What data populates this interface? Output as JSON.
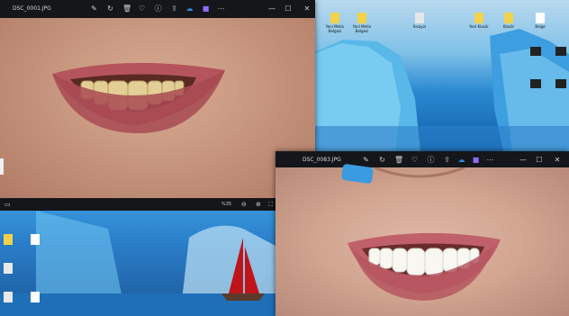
{
  "window1": {
    "filename": "DSC_0001.JPG",
    "icons": [
      "edit-icon",
      "rotate-icon",
      "delete-icon",
      "favorite-icon",
      "info-icon",
      "share-icon",
      "cloud-icon",
      "app-icon",
      "more-icon"
    ],
    "controls": {
      "minimize": "—",
      "maximize": "☐",
      "close": "✕"
    }
  },
  "window2": {
    "filename": "DSC_0083.JPG",
    "icons": [
      "edit-icon",
      "rotate-icon",
      "delete-icon",
      "favorite-icon",
      "info-icon",
      "share-icon",
      "cloud-icon",
      "app-icon",
      "more-icon"
    ],
    "controls": {
      "minimize": "—",
      "maximize": "☐",
      "close": "✕"
    }
  },
  "bottom_left": {
    "zoom_label": "%35",
    "zoom_in": "⊕",
    "zoom_out": "⊖"
  },
  "desktop_right_icons": [
    {
      "label": "Yeni Metin Belgesi"
    },
    {
      "label": "Yeni Metin Belgesi"
    },
    {
      "label": "Kısayol"
    },
    {
      "label": "Yeni Klasör"
    },
    {
      "label": "Klasör"
    },
    {
      "label": "Belge"
    }
  ],
  "colors": {
    "accent": "#2f8de4",
    "ice": "#4aa9e0",
    "sail": "#c0141b"
  }
}
